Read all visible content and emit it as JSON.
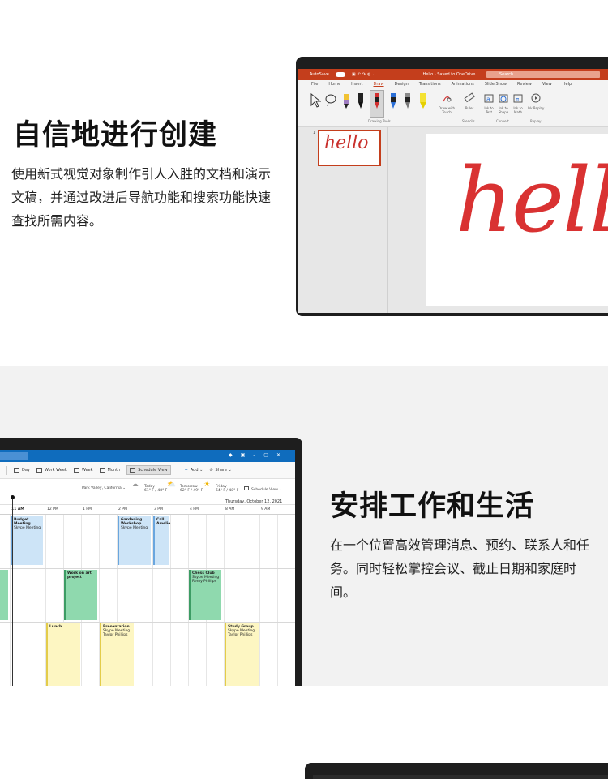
{
  "section1": {
    "heading": "自信地进行创建",
    "body": "使用新式视觉对象制作引人入胜的文档和演示文稿，并通过改进后导航功能和搜索功能快速查找所需内容。",
    "powerpoint": {
      "autosave": "AutoSave",
      "doc_title": "Hello - Saved to OneDrive",
      "search_placeholder": "Search",
      "tabs": [
        "File",
        "Home",
        "Insert",
        "Draw",
        "Design",
        "Transitions",
        "Animations",
        "Slide Show",
        "Review",
        "View",
        "Help"
      ],
      "active_tab": "Draw",
      "group_drawing_tools": "Drawing Tools",
      "group_stencils": "Stencils",
      "group_convert": "Convert",
      "group_replay": "Replay",
      "draw_with_touch": "Draw with Touch",
      "ruler": "Ruler",
      "ink_to_text": "Ink to Text",
      "ink_to_shape": "Ink to Shape",
      "ink_to_math": "Ink to Math",
      "ink_replay": "Ink Replay",
      "slide_number": "1",
      "slide_text": "hello"
    }
  },
  "section2": {
    "heading": "安排工作和生活",
    "body": "在一个位置高效管理消息、预约、联系人和任务。同时轻松掌控会议、截止日期和家庭时间。",
    "outlook": {
      "toolbar": [
        "Day",
        "Work Week",
        "Week",
        "Month",
        "Schedule View"
      ],
      "add_label": "Add",
      "share_label": "Share",
      "location": "Park Valley, California",
      "weather": [
        {
          "day": "Today",
          "temp": "61° F / 48° F"
        },
        {
          "day": "Tomorrow",
          "temp": "62° F / 49° F"
        },
        {
          "day": "Friday",
          "temp": "64° F / 48° F"
        }
      ],
      "view_select": "Schedule View",
      "date": "Thursday, October 12, 2021",
      "times": [
        "11 AM",
        "12 PM",
        "1 PM",
        "2 PM",
        "3 PM",
        "4 PM",
        "8 AM",
        "9 AM"
      ],
      "events": [
        {
          "title": "Budget Meeting",
          "sub": "Skype Meeting",
          "who": ""
        },
        {
          "title": "Gardening Workshop",
          "sub": "Skype Meeting",
          "who": ""
        },
        {
          "title": "Call Amelie",
          "sub": "",
          "who": ""
        },
        {
          "title": "Work on art project",
          "sub": "",
          "who": ""
        },
        {
          "title": "Chess Club",
          "sub": "Skype Meeting",
          "who": "Remy Phillips"
        },
        {
          "title": "Lunch",
          "sub": "",
          "who": ""
        },
        {
          "title": "Presentation",
          "sub": "Skype Meeting",
          "who": "Taylor Phillips"
        },
        {
          "title": "Study Group",
          "sub": "Skype Meeting",
          "who": "Taylor Phillips"
        }
      ]
    }
  }
}
